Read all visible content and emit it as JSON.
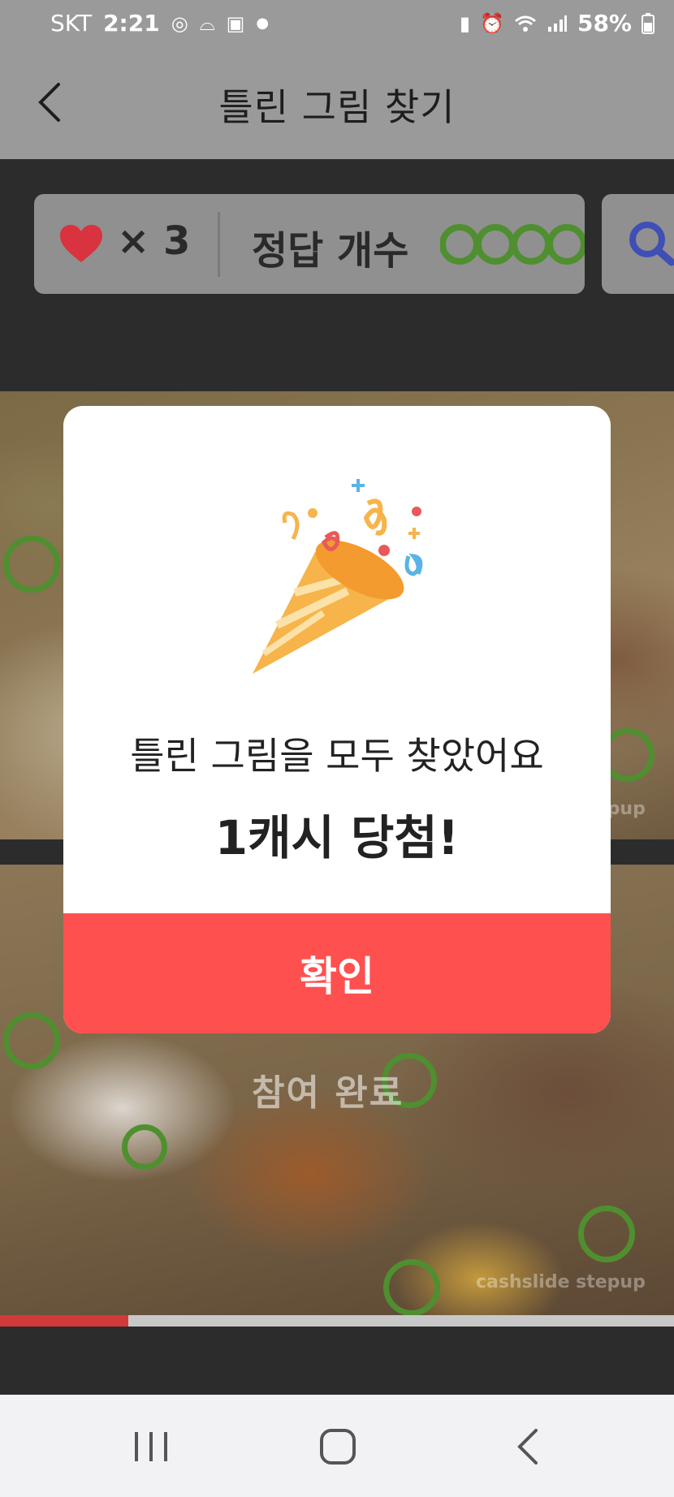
{
  "status_bar": {
    "carrier": "SKT",
    "time": "2:21",
    "battery": "58%",
    "left_icons": [
      "at-sign-icon",
      "mustache-icon",
      "gallery-icon",
      "dot-icon"
    ],
    "right_icons": [
      "battery-saver-icon",
      "alarm-icon",
      "wifi-icon",
      "signal-icon",
      "battery-icon"
    ]
  },
  "header": {
    "title": "틀린 그림 찾기",
    "back_icon": "chevron-left-icon"
  },
  "score": {
    "lives_prefix": "×",
    "lives": "3",
    "answers_label": "정답 개수",
    "found_count": 4,
    "heart_color": "#d9333f",
    "circle_color": "#4f8f2f",
    "search_icon_color": "#3f4fb5"
  },
  "game": {
    "done_label": "참여 완료",
    "watermark": "cashslide stepup",
    "progress": 0.19,
    "progress_color": "#d23a3a"
  },
  "modal": {
    "message": "틀린 그림을 모두 찾았어요",
    "reward": "1캐시 당첨!",
    "confirm_label": "확인",
    "confirm_color": "#ff5050",
    "illustration": "party-popper-icon"
  },
  "nav_bar": {
    "icons": [
      "recent-apps-icon",
      "home-icon",
      "back-icon"
    ]
  }
}
